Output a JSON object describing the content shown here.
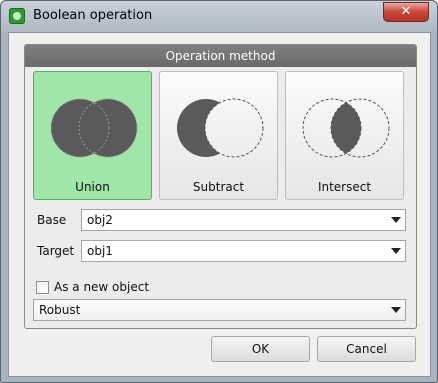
{
  "window": {
    "title": "Boolean operation",
    "close_glyph": "✕"
  },
  "group": {
    "title": "Operation method"
  },
  "methods": [
    {
      "label": "Union",
      "icon": "union-icon",
      "selected": true
    },
    {
      "label": "Subtract",
      "icon": "subtract-icon",
      "selected": false
    },
    {
      "label": "Intersect",
      "icon": "intersect-icon",
      "selected": false
    }
  ],
  "base": {
    "label": "Base",
    "value": "obj2"
  },
  "target": {
    "label": "Target",
    "value": "obj1"
  },
  "as_new_object": {
    "label": "As a new object",
    "checked": false
  },
  "mode": {
    "value": "Robust"
  },
  "buttons": {
    "ok": "OK",
    "cancel": "Cancel"
  },
  "colors": {
    "selected": "#9fe6a8",
    "shape_fill": "#5a5a5a",
    "header": "#7a7a7a"
  }
}
